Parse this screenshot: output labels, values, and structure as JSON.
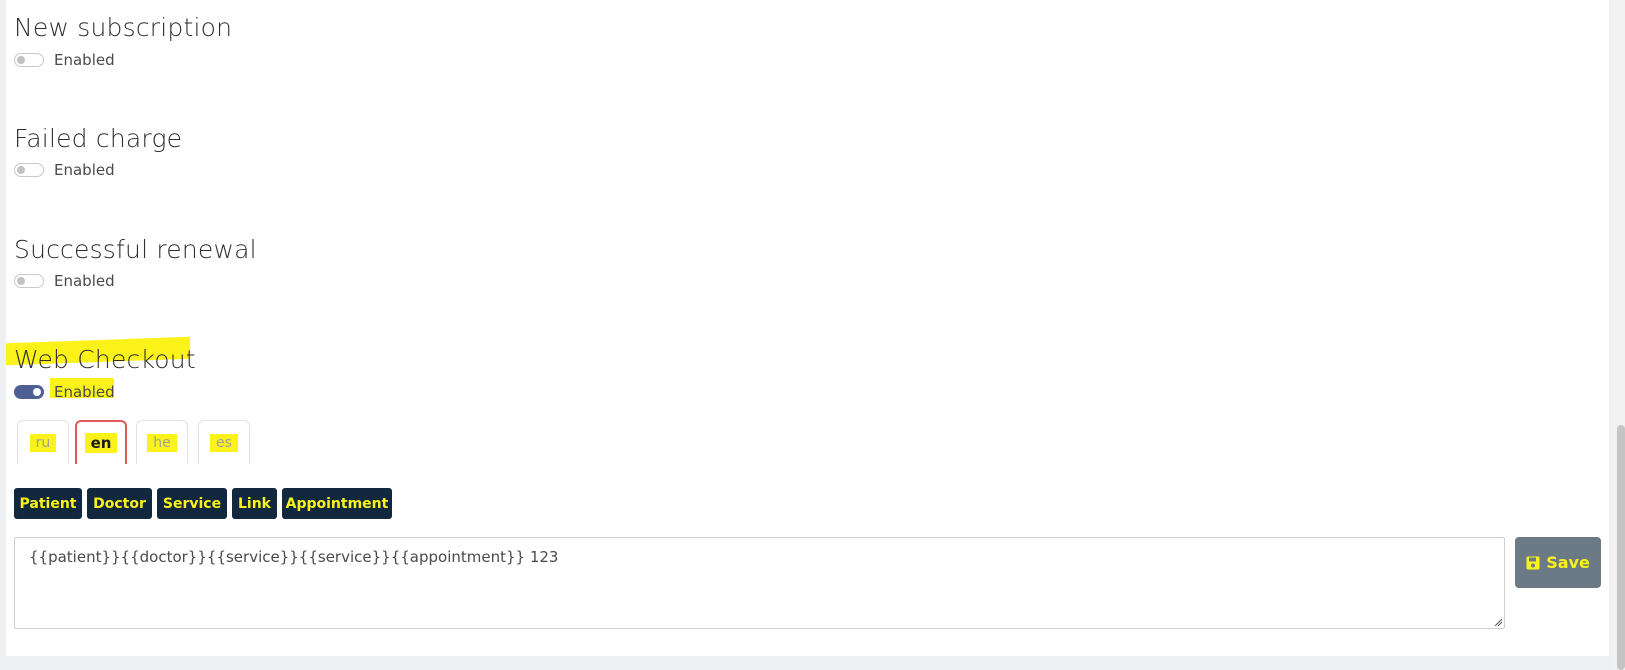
{
  "sections": [
    {
      "title": "New subscription",
      "toggle_label": "Enabled",
      "enabled": false
    },
    {
      "title": "Failed charge",
      "toggle_label": "Enabled",
      "enabled": false
    },
    {
      "title": "Successful renewal",
      "toggle_label": "Enabled",
      "enabled": false
    },
    {
      "title": "Web Checkout",
      "toggle_label": "Enabled",
      "enabled": true
    }
  ],
  "language_tabs": [
    {
      "label": "ru",
      "active": false
    },
    {
      "label": "en",
      "active": true
    },
    {
      "label": "he",
      "active": false
    },
    {
      "label": "es",
      "active": false
    }
  ],
  "variable_buttons": [
    "Patient",
    "Doctor",
    "Service",
    "Link",
    "Appointment"
  ],
  "template": {
    "value": "{{patient}}{{doctor}}{{service}}{{service}}{{appointment}} 123"
  },
  "save_button": {
    "label": "Save",
    "icon": "floppy-disk-icon"
  },
  "colors": {
    "highlight": "#fbf21a",
    "toggle_on": "#4e5f96",
    "variable_button_bg": "#12283e",
    "save_button_bg": "#6c7a86",
    "active_tab_border": "#e05b55"
  }
}
